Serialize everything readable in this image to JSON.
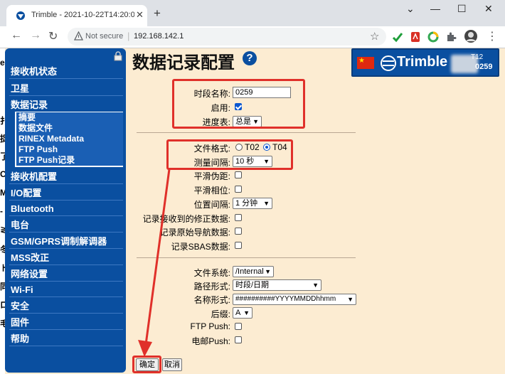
{
  "browser": {
    "tab_title": "Trimble - 2021-10-22T14:20:02Z",
    "tab_close": "✕",
    "new_tab": "+",
    "window_controls": [
      "⌄",
      "—",
      "☐",
      "✕"
    ],
    "back": "←",
    "forward": "→",
    "reload": "↻",
    "not_secure": "Not secure",
    "url_separator": "|",
    "url": "192.168.142.1",
    "bookmark": "☆"
  },
  "sidebar": {
    "items": [
      "接收机状态",
      "卫星",
      "数据记录",
      "接收机配置",
      "I/O配置",
      "Bluetooth",
      "电台",
      "GSM/GPRS调制解调器",
      "MSS改正",
      "网络设置",
      "Wi-Fi",
      "安全",
      "固件",
      "帮助"
    ],
    "sub_items": [
      "摘要",
      "数据文件",
      "RINEX Metadata",
      "FTP Push",
      "FTP Push记录"
    ]
  },
  "main": {
    "title": "数据记录配置",
    "help": "?",
    "logo_text": "Trimble",
    "logo_model": "T12",
    "logo_serial": "0259",
    "session_name_label": "时段名称:",
    "session_name_value": "0259",
    "enable_label": "启用:",
    "schedule_label": "进度表:",
    "schedule_value": "总是",
    "file_format_label": "文件格式:",
    "format_t02": "T02",
    "format_t04": "T04",
    "interval_label": "测量间隔:",
    "interval_value": "10 秒",
    "smooth_pr_label": "平滑伪距:",
    "smooth_phase_label": "平滑相位:",
    "pos_interval_label": "位置间隔:",
    "pos_interval_value": "1 分钟",
    "record_corr_label": "记录接收到的修正数据:",
    "record_nav_label": "记录原始导航数据:",
    "record_sbas_label": "记录SBAS数据:",
    "filesystem_label": "文件系统:",
    "filesystem_value": "/Internal",
    "path_style_label": "路径形式:",
    "path_style_value": "时段/日期",
    "name_style_label": "名称形式:",
    "name_style_value": "##########YYYYMMDDhhmm",
    "suffix_label": "后缀:",
    "suffix_value": "A",
    "ftp_push_label": "FTP Push:",
    "email_push_label": "电邮Push:",
    "ok_button": "确定",
    "cancel_button": "取消"
  },
  "colors": {
    "accent": "#0a4fa0",
    "page_bg": "#fcecd2",
    "highlight": "#e0302a"
  }
}
